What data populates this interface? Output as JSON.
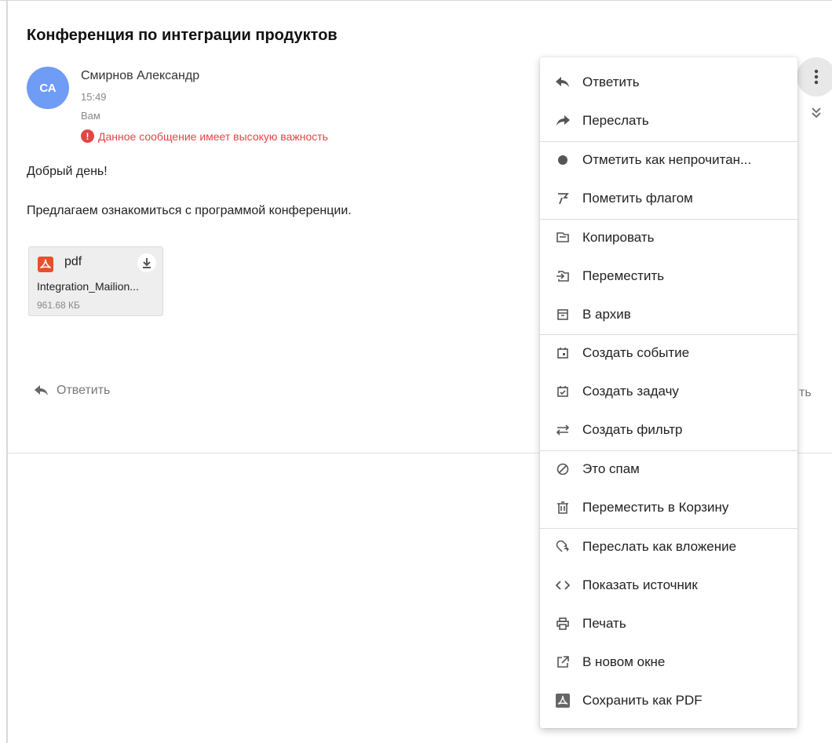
{
  "message": {
    "subject": "Конференция по интеграции продуктов",
    "avatar_initials": "СА",
    "sender": "Смирнов Александр",
    "time": "15:49",
    "recipient": "Вам",
    "importance_text": "Данное сообщение имеет высокую важность",
    "greeting": "Добрый день!",
    "body": "Предлагаем ознакомиться с программой конференции.",
    "colors": {
      "avatar": "#6f9cf5",
      "importance": "#e04646",
      "pdf": "#e8502a"
    }
  },
  "attachment": {
    "type": "pdf",
    "name": "Integration_Mailion...",
    "size": "961.68 КБ",
    "download_icon": "download-icon"
  },
  "footer": {
    "reply_label": "Ответить",
    "partial_right": "ть"
  },
  "menu": {
    "items": [
      {
        "label": "Ответить",
        "icon": "reply-icon"
      },
      {
        "label": "Переслать",
        "icon": "forward-icon"
      },
      {
        "label": "Отметить как непрочитан...",
        "icon": "unread-dot-icon"
      },
      {
        "label": "Пометить флагом",
        "icon": "flag-icon"
      },
      {
        "label": "Копировать",
        "icon": "copy-icon"
      },
      {
        "label": "Переместить",
        "icon": "move-icon"
      },
      {
        "label": "В архив",
        "icon": "archive-icon"
      },
      {
        "label": "Создать событие",
        "icon": "calendar-event-icon"
      },
      {
        "label": "Создать задачу",
        "icon": "task-icon"
      },
      {
        "label": "Создать фильтр",
        "icon": "filter-icon"
      },
      {
        "label": "Это спам",
        "icon": "spam-icon"
      },
      {
        "label": "Переместить в Корзину",
        "icon": "trash-icon"
      },
      {
        "label": "Переслать как вложение",
        "icon": "forward-attachment-icon"
      },
      {
        "label": "Показать источник",
        "icon": "code-icon"
      },
      {
        "label": "Печать",
        "icon": "print-icon"
      },
      {
        "label": "В новом окне",
        "icon": "new-window-icon"
      },
      {
        "label": "Сохранить как PDF",
        "icon": "pdf-icon"
      }
    ]
  }
}
